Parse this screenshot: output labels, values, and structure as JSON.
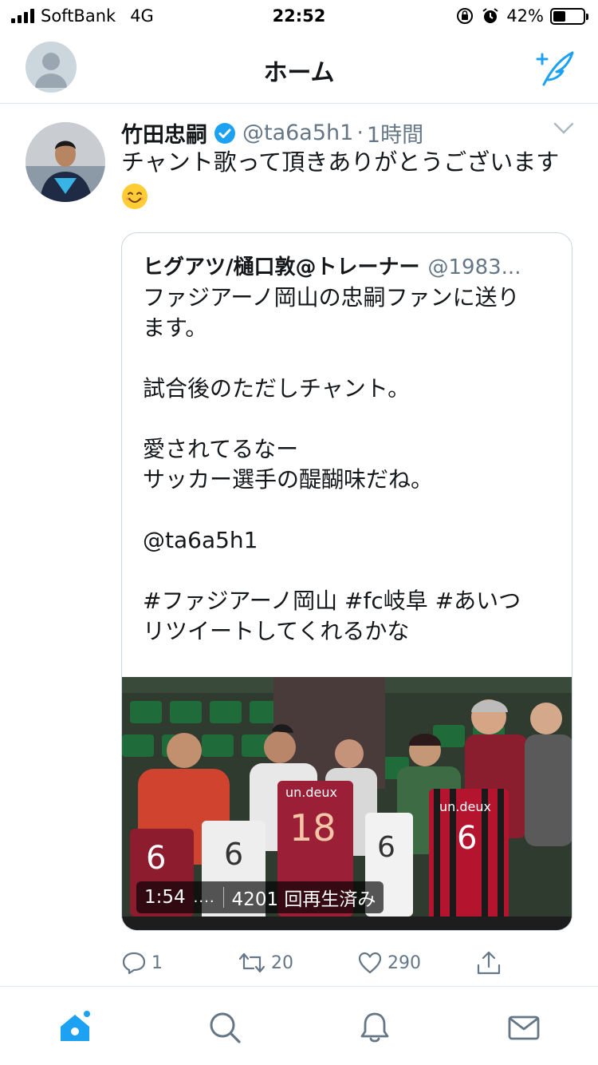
{
  "status_bar": {
    "carrier": "SoftBank",
    "network": "4G",
    "time": "22:52",
    "battery_percent": "42%",
    "battery_level": 0.42,
    "icons": [
      "signal-icon",
      "orientation-lock-icon",
      "alarm-icon",
      "battery-icon"
    ]
  },
  "nav": {
    "title": "ホーム",
    "accent_color": "#1da1f2"
  },
  "tweet": {
    "author_name": "竹田忠嗣",
    "handle": "@ta6a5h1",
    "dot": "·",
    "time": "1時間",
    "text": "チャント歌って頂きありがとうございます",
    "emoji": "smiling-face-icon",
    "quote": {
      "author_name": "ヒグアツ/樋口敦@トレーナー",
      "handle": "@1983...",
      "lines": [
        "ファジアーノ岡山の忠嗣ファンに送り",
        "ます。",
        "",
        "試合後のただしチャント。",
        "",
        "愛されてるなー",
        "サッカー選手の醍醐味だね。",
        "",
        "@ta6a5h1",
        "",
        "#ファジアーノ岡山 #fc岐阜 #あいつ",
        "リツイートしてくれるかな"
      ],
      "video": {
        "duration": "1:54",
        "dots": "....",
        "views": "4201 回再生済み"
      }
    },
    "actions": {
      "replies": "1",
      "retweets": "20",
      "likes": "290"
    }
  },
  "tabs": [
    "home-icon",
    "search-icon",
    "notifications-icon",
    "messages-icon"
  ]
}
